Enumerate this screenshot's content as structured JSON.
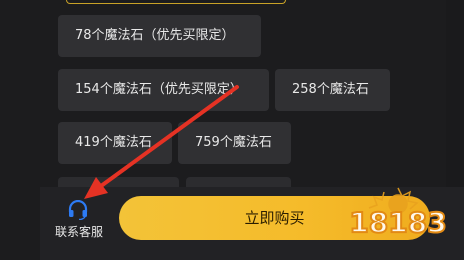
{
  "options": [
    {
      "label": "78个魔法石（优先买限定）"
    },
    {
      "label": "154个魔法石（优先买限定）"
    },
    {
      "label": "258个魔法石"
    },
    {
      "label": "419个魔法石"
    },
    {
      "label": "759个魔法石"
    }
  ],
  "bottom": {
    "contact_label": "联系客服",
    "buy_label": "立即购买"
  },
  "watermark": {
    "text": "18183"
  },
  "colors": {
    "background": "#1c1c1e",
    "option_bg": "#303033",
    "buy_button": "#f5bb2a",
    "contact_icon": "#2d7bf4",
    "annotation_arrow": "#e53224"
  },
  "icons": {
    "contact": "headset-icon"
  }
}
